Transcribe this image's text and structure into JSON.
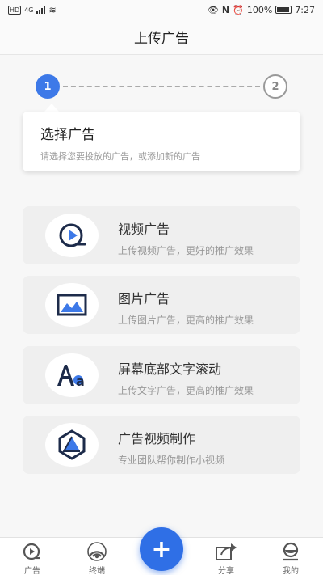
{
  "status_bar": {
    "hd": "HD",
    "network": "4G",
    "battery_text": "100%",
    "time": "7:27"
  },
  "header": {
    "title": "上传广告"
  },
  "stepper": {
    "steps": [
      {
        "number": "1",
        "active": true
      },
      {
        "number": "2",
        "active": false
      }
    ]
  },
  "step_card": {
    "title": "选择广告",
    "subtitle": "请选择您要投放的广告，或添加新的广告"
  },
  "options": [
    {
      "icon": "video-play-icon",
      "title": "视频广告",
      "subtitle": "上传视频广告，更好的推广效果"
    },
    {
      "icon": "image-icon",
      "title": "图片广告",
      "subtitle": "上传图片广告，更高的推广效果"
    },
    {
      "icon": "text-aa-icon",
      "title": "屏幕底部文字滚动",
      "subtitle": "上传文字广告，更高的推广效果"
    },
    {
      "icon": "production-icon",
      "title": "广告视频制作",
      "subtitle": "专业团队帮你制作小视频"
    }
  ],
  "tabbar": {
    "tabs": [
      {
        "label": "广告",
        "icon": "ad-play-icon"
      },
      {
        "label": "终端",
        "icon": "terminal-signal-icon"
      },
      {
        "label": "分享",
        "icon": "share-icon"
      },
      {
        "label": "我的",
        "icon": "profile-icon"
      }
    ],
    "fab_label": "+"
  },
  "colors": {
    "accent": "#3d79e8",
    "fab": "#2f6fe6",
    "navy": "#1d2b4a"
  }
}
